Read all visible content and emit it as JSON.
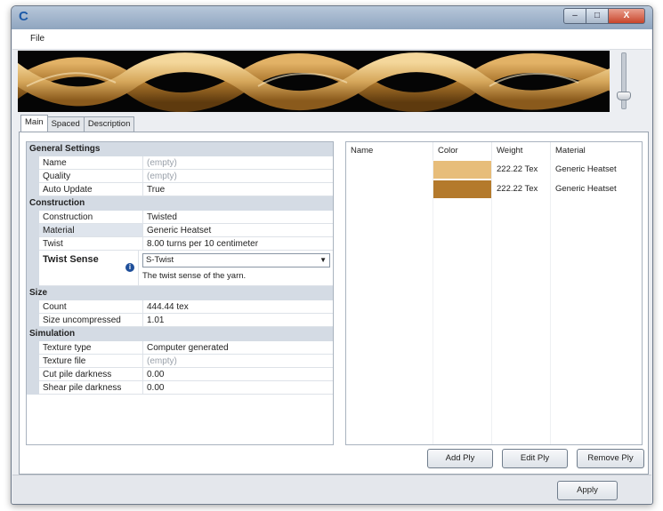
{
  "window": {
    "logo": "C",
    "buttons": {
      "minimize": "–",
      "maximize": "□",
      "close": "X"
    }
  },
  "menu": {
    "file": "File"
  },
  "tabs": [
    {
      "label": "Main",
      "active": true
    },
    {
      "label": "Spaced",
      "active": false
    },
    {
      "label": "Description",
      "active": false
    }
  ],
  "properties": {
    "general": {
      "title": "General Settings",
      "rows": [
        {
          "name": "Name",
          "value": "(empty)",
          "gray": true
        },
        {
          "name": "Quality",
          "value": "(empty)",
          "gray": true
        },
        {
          "name": "Auto Update",
          "value": "True"
        }
      ]
    },
    "construction": {
      "title": "Construction",
      "rows": [
        {
          "name": "Construction",
          "value": "Twisted"
        },
        {
          "name": "Material",
          "value": "Generic Heatset"
        },
        {
          "name": "Twist",
          "value": "8.00 turns per 10 centimeter"
        }
      ],
      "twist_sense": {
        "name": "Twist Sense",
        "value": "S-Twist",
        "description": "The twist sense of the yarn."
      }
    },
    "size": {
      "title": "Size",
      "rows": [
        {
          "name": "Count",
          "value": "444.44 tex"
        },
        {
          "name": "Size uncompressed",
          "value": "1.01"
        }
      ]
    },
    "simulation": {
      "title": "Simulation",
      "rows": [
        {
          "name": "Texture type",
          "value": "Computer generated"
        },
        {
          "name": "Texture file",
          "value": "(empty)",
          "gray": true
        },
        {
          "name": "Cut pile darkness",
          "value": "0.00"
        },
        {
          "name": "Shear pile darkness",
          "value": "0.00"
        }
      ]
    }
  },
  "ply_table": {
    "headers": {
      "name": "Name",
      "color": "Color",
      "weight": "Weight",
      "material": "Material"
    },
    "rows": [
      {
        "name": "",
        "color": "#e7bd7a",
        "weight": "222.22 Tex",
        "material": "Generic Heatset"
      },
      {
        "name": "",
        "color": "#b47a2c",
        "weight": "222.22 Tex",
        "material": "Generic Heatset"
      }
    ]
  },
  "buttons": {
    "add_ply": "Add Ply",
    "edit_ply": "Edit Ply",
    "remove_ply": "Remove Ply",
    "apply": "Apply"
  }
}
